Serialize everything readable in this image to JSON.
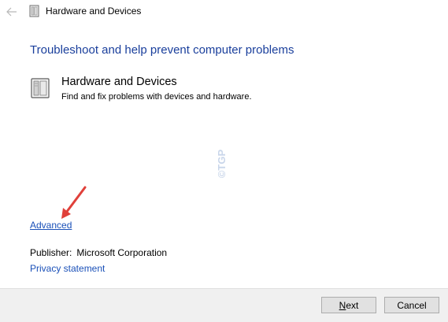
{
  "titlebar": {
    "back_icon": "back-arrow-icon",
    "app_icon": "hardware-device-icon",
    "title": "Hardware and Devices"
  },
  "main": {
    "heading": "Troubleshoot and help prevent computer problems",
    "item": {
      "icon": "hardware-device-icon",
      "title": "Hardware and Devices",
      "description": "Find and fix problems with devices and hardware."
    },
    "watermark": "©TGP",
    "advanced_link": "Advanced",
    "publisher_label": "Publisher:",
    "publisher_value": "Microsoft Corporation",
    "privacy_link": "Privacy statement"
  },
  "footer": {
    "next_label": "Next",
    "cancel_label": "Cancel"
  },
  "colors": {
    "heading": "#1a3f9c",
    "link": "#1a50b8",
    "annotation_arrow": "#e0403a",
    "footer_bg": "#f0f0f0"
  }
}
